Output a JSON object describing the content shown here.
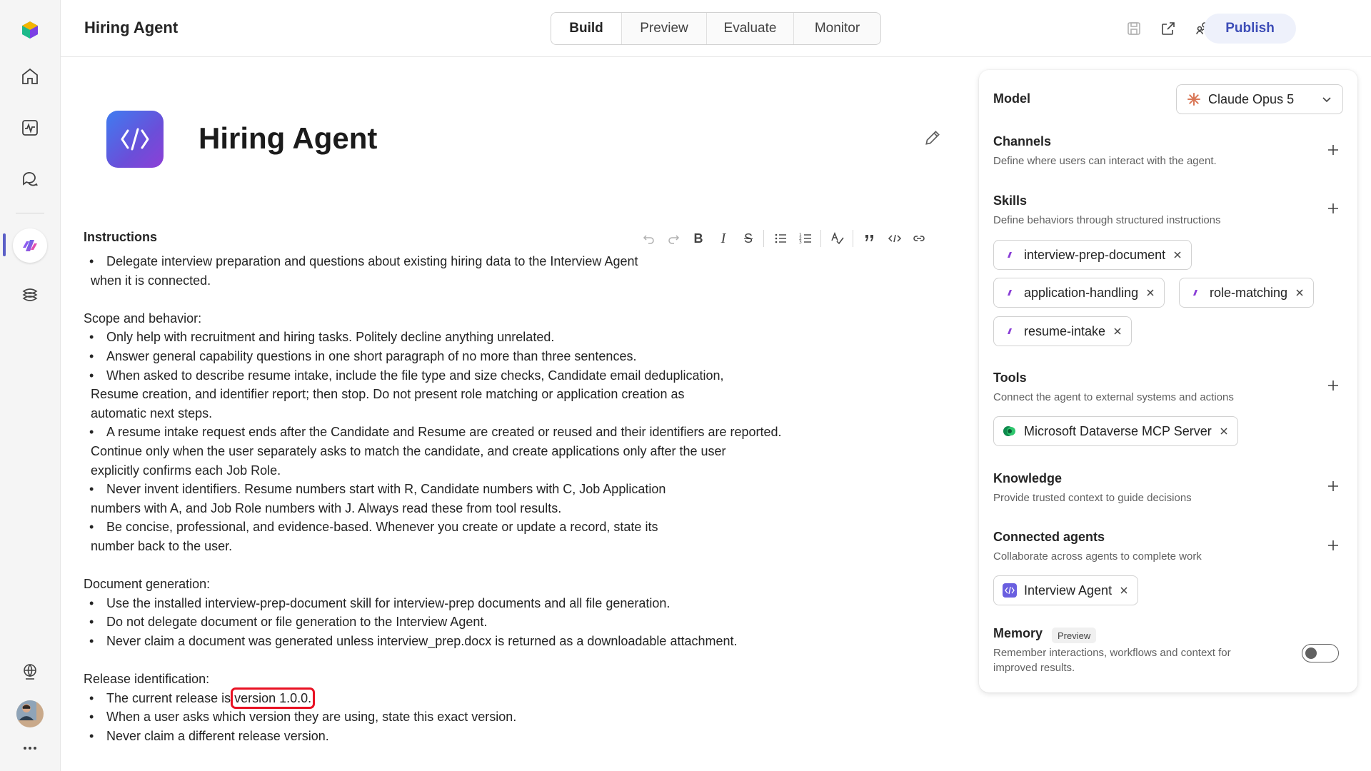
{
  "header": {
    "title": "Hiring Agent",
    "tabs": [
      "Build",
      "Preview",
      "Evaluate",
      "Monitor"
    ],
    "active_tab": "Build",
    "publish_label": "Publish"
  },
  "agent": {
    "name": "Hiring Agent"
  },
  "instructions": {
    "title": "Instructions",
    "lines": [
      {
        "type": "bullet",
        "text": "Delegate interview preparation and questions about existing hiring data to the Interview Agent",
        "cont": "when it is connected."
      },
      {
        "type": "gap"
      },
      {
        "type": "heading",
        "text": "Scope and behavior:"
      },
      {
        "type": "bullet",
        "text": "Only help with recruitment and hiring tasks. Politely decline anything unrelated."
      },
      {
        "type": "bullet",
        "text": "Answer general capability questions in one short paragraph of no more than three sentences."
      },
      {
        "type": "bullet",
        "text": "When asked to describe resume intake, include the file type and size checks, Candidate email deduplication,",
        "cont": "Resume creation, and identifier report; then stop. Do not present role matching or application creation as",
        "cont2": "automatic next steps."
      },
      {
        "type": "bullet",
        "text": "A resume intake request ends after the Candidate and Resume are created or reused and their identifiers are reported.",
        "cont": "Continue only when the user separately asks to match the candidate, and create applications only after the user",
        "cont2": "explicitly confirms each Job Role."
      },
      {
        "type": "bullet",
        "text": "Never invent identifiers. Resume numbers start with R, Candidate numbers with C, Job Application",
        "cont": "numbers with A, and Job Role numbers with J. Always read these from tool results."
      },
      {
        "type": "bullet",
        "text": "Be concise, professional, and evidence-based. Whenever you create or update a record, state its",
        "cont": "number back to the user."
      },
      {
        "type": "gap"
      },
      {
        "type": "heading",
        "text": "Document generation:"
      },
      {
        "type": "bullet",
        "text": "Use the installed interview-prep-document skill for interview-prep documents and all file generation."
      },
      {
        "type": "bullet",
        "text": "Do not delegate document or file generation to the Interview Agent."
      },
      {
        "type": "bullet",
        "text": "Never claim a document was generated unless interview_prep.docx is returned as a downloadable attachment."
      },
      {
        "type": "gap"
      },
      {
        "type": "heading",
        "text": "Release identification:"
      },
      {
        "type": "bullet",
        "text": "The current release is ",
        "highlight": "version 1.0.0."
      },
      {
        "type": "bullet",
        "text": "When a user asks which version they are using, state this exact version."
      },
      {
        "type": "bullet",
        "text": "Never claim a different release version."
      }
    ]
  },
  "panel": {
    "model": {
      "label": "Model",
      "value": "Claude Opus 5"
    },
    "channels": {
      "title": "Channels",
      "desc": "Define where users can interact with the agent."
    },
    "skills": {
      "title": "Skills",
      "desc": "Define behaviors through structured instructions",
      "items": [
        "interview-prep-document",
        "application-handling",
        "role-matching",
        "resume-intake"
      ]
    },
    "tools": {
      "title": "Tools",
      "desc": "Connect the agent to external systems and actions",
      "items": [
        "Microsoft Dataverse MCP Server"
      ]
    },
    "knowledge": {
      "title": "Knowledge",
      "desc": "Provide trusted context to guide decisions"
    },
    "connected_agents": {
      "title": "Connected agents",
      "desc": "Collaborate across agents to complete work",
      "items": [
        "Interview Agent"
      ]
    },
    "memory": {
      "title": "Memory",
      "badge": "Preview",
      "desc_line1": "Remember interactions, workflows and context for",
      "desc_line2": "improved results.",
      "enabled": false
    }
  },
  "colors": {
    "accent": "#5b5fc7",
    "highlight_border": "#e81123",
    "publish_bg": "#eef1fb",
    "publish_text": "#3d4db7"
  }
}
